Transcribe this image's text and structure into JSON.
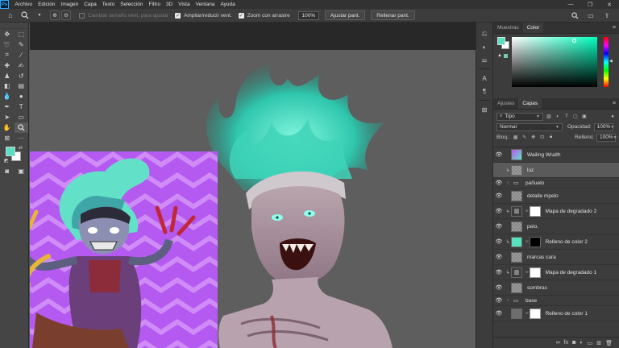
{
  "menubar": {
    "logo": "Ps",
    "items": [
      "Archivo",
      "Edición",
      "Imagen",
      "Capa",
      "Texto",
      "Selección",
      "Filtro",
      "3D",
      "Vista",
      "Ventana",
      "Ayuda"
    ],
    "window_controls": [
      "—",
      "❐",
      "✕"
    ]
  },
  "options": {
    "opt_resize_windows": "Cambiar tamaño vent. para ajustar",
    "opt_zoom_all": "Ampliar/reducir vent.",
    "opt_scrubby_zoom": "Zoom con arrastre",
    "zoom_value": "100%",
    "fit_screen": "Ajustar pant.",
    "fill_screen": "Rellenar pant."
  },
  "color_panel": {
    "tabs": [
      "Muestras",
      "Color"
    ],
    "active_tab": "Color",
    "foreground": "#58e1c0",
    "background": "#ffffff"
  },
  "layers_panel": {
    "tabs": [
      "Ajustes",
      "Capas"
    ],
    "active_tab": "Capas",
    "filter_value": "Tipo",
    "blend_mode": "Normal",
    "opacity_label": "Opacidad:",
    "opacity_value": "100%",
    "lock_label": "Bloq.:",
    "fill_label": "Relleno:",
    "fill_value": "100%",
    "layers": [
      {
        "name": "Wailing Wraith",
        "type": "smart",
        "selected": false,
        "clip": false
      },
      {
        "name": "luz",
        "type": "pixel",
        "selected": true,
        "clip": true
      },
      {
        "name": "pañuelo",
        "type": "group",
        "selected": false,
        "clip": false
      },
      {
        "name": "detalle mpelo",
        "type": "pixel",
        "selected": false,
        "clip": false
      },
      {
        "name": "Mapa de degradado 2",
        "type": "adjust",
        "selected": false,
        "clip": true
      },
      {
        "name": "pelo.",
        "type": "pixel",
        "selected": false,
        "clip": false
      },
      {
        "name": "Relleno de color 2",
        "type": "fill",
        "selected": false,
        "clip": true
      },
      {
        "name": "marcas cara",
        "type": "pixel",
        "selected": false,
        "clip": false
      },
      {
        "name": "Mapa de degradado 1",
        "type": "adjust",
        "selected": false,
        "clip": true
      },
      {
        "name": "sombras",
        "type": "pixel",
        "selected": false,
        "clip": false
      },
      {
        "name": "base",
        "type": "group",
        "selected": false,
        "clip": false
      },
      {
        "name": "Relleno de color 1",
        "type": "fillbase",
        "selected": false,
        "clip": false
      }
    ]
  },
  "toolbar": {
    "foreground": "#58e1c0",
    "background": "#ffffff"
  }
}
